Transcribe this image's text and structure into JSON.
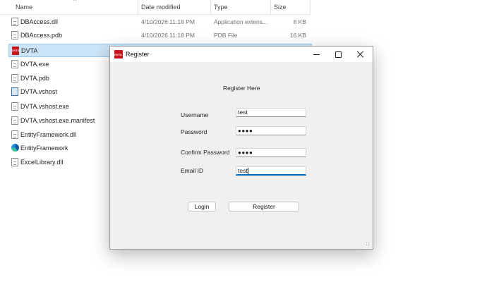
{
  "explorer": {
    "columns": {
      "name": "Name",
      "date_modified": "Date modified",
      "type": "Type",
      "size": "Size"
    },
    "files": [
      {
        "name": "DBAccess.dll",
        "date": "4/10/2026 11:18 PM",
        "type": "Application extens...",
        "size": "8 KB",
        "icon": "dll-file-icon"
      },
      {
        "name": "DBAccess.pdb",
        "date": "4/10/2026 11:18 PM",
        "type": "PDB File",
        "size": "16 KB",
        "icon": "pdb-file-icon"
      },
      {
        "name": "DVTA",
        "date": "",
        "type": "",
        "size": "",
        "icon": "dvta-app-icon",
        "selected": true
      },
      {
        "name": "DVTA.exe",
        "date": "",
        "type": "",
        "size": "",
        "icon": "exe-file-icon"
      },
      {
        "name": "DVTA.pdb",
        "date": "",
        "type": "",
        "size": "",
        "icon": "pdb-file-icon"
      },
      {
        "name": "DVTA.vshost",
        "date": "",
        "type": "",
        "size": "",
        "icon": "vshost-icon"
      },
      {
        "name": "DVTA.vshost.exe",
        "date": "",
        "type": "",
        "size": "",
        "icon": "exe-file-icon"
      },
      {
        "name": "DVTA.vshost.exe.manifest",
        "date": "",
        "type": "",
        "size": "",
        "icon": "manifest-file-icon"
      },
      {
        "name": "EntityFramework.dll",
        "date": "",
        "type": "",
        "size": "",
        "icon": "dll-file-icon"
      },
      {
        "name": "EntityFramework",
        "date": "",
        "type": "",
        "size": "",
        "icon": "edge-icon"
      },
      {
        "name": "ExcelLibrary.dll",
        "date": "",
        "type": "",
        "size": "",
        "icon": "dll-file-icon"
      }
    ]
  },
  "dialog": {
    "title": "Register",
    "app_icon_text": "DVTA",
    "heading": "Register Here",
    "fields": {
      "username": {
        "label": "Username",
        "value": "test"
      },
      "password": {
        "label": "Password",
        "value": "●●●●"
      },
      "confirm_password": {
        "label": "Confirm Password",
        "value": "●●●●"
      },
      "email": {
        "label": "Email ID",
        "value": "test"
      }
    },
    "buttons": {
      "login": "Login",
      "register": "Register"
    }
  }
}
